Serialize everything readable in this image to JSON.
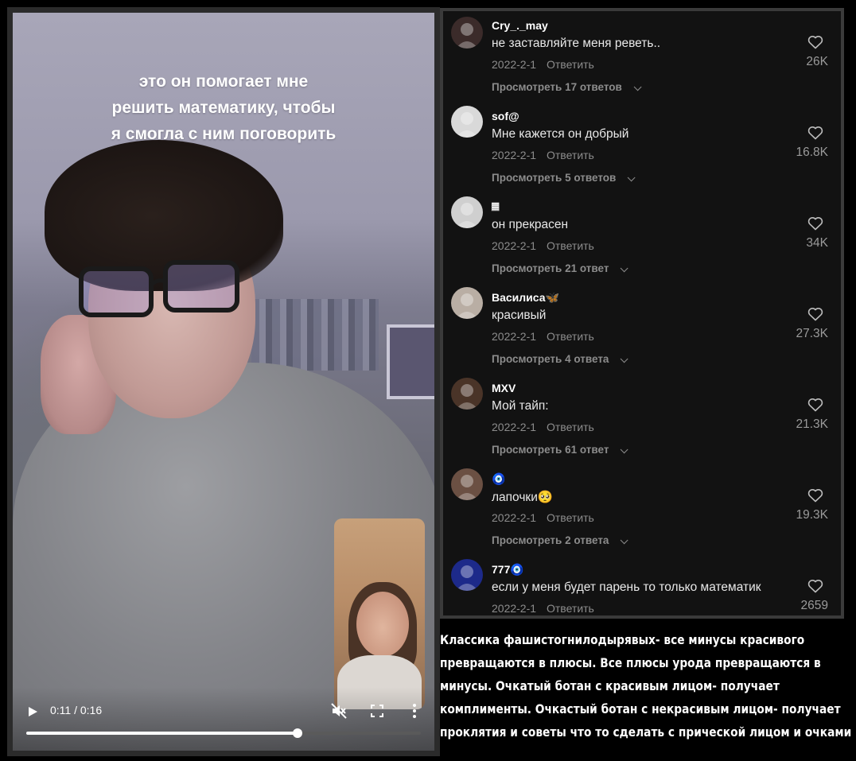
{
  "video": {
    "caption_lines": [
      "это он помогает мне",
      "решить математику, чтобы",
      "я смогла с ним поговорить"
    ],
    "time_display": "0:11 / 0:16",
    "progress": 0.6875,
    "icons": {
      "play": "play-icon",
      "mute": "muted-speaker-icon",
      "fullscreen": "fullscreen-icon",
      "more": "more-vertical-icon"
    }
  },
  "comments": [
    {
      "user": "Cry_._may",
      "text": "не заставляйте меня реветь..",
      "date": "2022-2-1",
      "reply": "Ответить",
      "view_replies": "Просмотреть 17 ответов",
      "likes": "26K",
      "avatar_color": "#3b2b2a"
    },
    {
      "user": "sof@",
      "text": "Мне кажется он добрый",
      "date": "2022-2-1",
      "reply": "Ответить",
      "view_replies": "Просмотреть 5 ответов",
      "likes": "16.8K",
      "avatar_color": "#d9d9d9"
    },
    {
      "user": "𝄜",
      "text": "он прекрасен",
      "date": "2022-2-1",
      "reply": "Ответить",
      "view_replies": "Просмотреть 21 ответ",
      "likes": "34K",
      "avatar_color": "#cfcfcf"
    },
    {
      "user": "Василиса🦋",
      "text": "красивый",
      "date": "2022-2-1",
      "reply": "Ответить",
      "view_replies": "Просмотреть 4 ответа",
      "likes": "27.3K",
      "avatar_color": "#b9aea4"
    },
    {
      "user": "MXV",
      "text": "Мой тайп:",
      "date": "2022-2-1",
      "reply": "Ответить",
      "view_replies": "Просмотреть 61 ответ",
      "likes": "21.3K",
      "avatar_color": "#4a3428"
    },
    {
      "user": "🧿",
      "text": "лапочки🥺",
      "date": "2022-2-1",
      "reply": "Ответить",
      "view_replies": "Просмотреть 2 ответа",
      "likes": "19.3K",
      "avatar_color": "#6b5043"
    },
    {
      "user": "777🧿",
      "text": "если у меня будет парень то только математик",
      "date": "2022-2-1",
      "reply": "Ответить",
      "view_replies": "",
      "likes": "2659",
      "avatar_color": "#1d2a8a"
    }
  ],
  "commentary_lines": [
    "Классика фашистогнилодырявых- все минусы красивого",
    "превращаются в плюсы. Все плюсы урода превращаются в",
    "минусы. Очкатый ботан с красивым лицом- получает",
    "комплименты. Очкастый ботан с некрасивым лицом- получает",
    "проклятия и советы что то сделать с прической лицом и очками"
  ],
  "colors": {
    "panel_bg": "#121212",
    "muted_text": "#8c8c8c",
    "accent": "#ffffff"
  }
}
